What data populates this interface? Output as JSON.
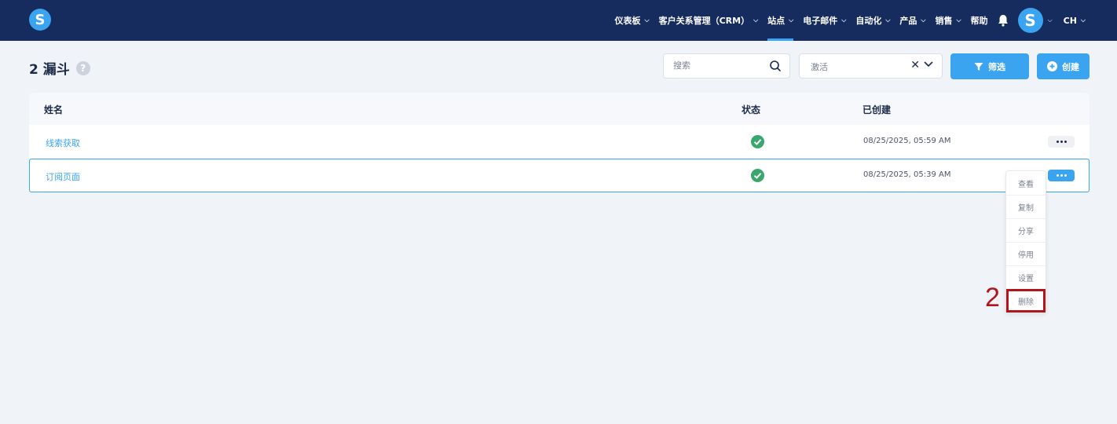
{
  "header": {
    "logo_letter": "S",
    "nav": [
      {
        "label": "仪表板",
        "chevron": true,
        "active": false
      },
      {
        "label": "客户关系管理（CRM）",
        "chevron": true,
        "active": false
      },
      {
        "label": "站点",
        "chevron": true,
        "active": true
      },
      {
        "label": "电子邮件",
        "chevron": true,
        "active": false
      },
      {
        "label": "自动化",
        "chevron": true,
        "active": false
      },
      {
        "label": "产品",
        "chevron": true,
        "active": false
      },
      {
        "label": "销售",
        "chevron": true,
        "active": false
      },
      {
        "label": "帮助",
        "chevron": false,
        "active": false
      }
    ],
    "notification_icon": "bell-icon",
    "avatar_letter": "S",
    "language": "CH"
  },
  "page": {
    "title": "2 漏斗",
    "help_icon": "?",
    "search_placeholder": "搜索",
    "status_filter_value": "激活",
    "filter_button": "筛选",
    "create_button": "创建"
  },
  "table": {
    "headers": {
      "name": "姓名",
      "status": "状态",
      "created": "已创建"
    },
    "rows": [
      {
        "name": "线索获取",
        "status": "active",
        "created": "08/25/2025, 05:59 AM"
      },
      {
        "name": "订阅页面",
        "status": "active",
        "created": "08/25/2025, 05:39 AM"
      }
    ]
  },
  "context_menu": {
    "items": [
      "查看",
      "复制",
      "分享",
      "停用",
      "设置",
      "删除"
    ]
  },
  "annotation": {
    "label": "2"
  },
  "colors": {
    "topbar": "#162c5e",
    "accent": "#3ba4f0",
    "success": "#3aa76d",
    "annotation": "#b2161b"
  }
}
